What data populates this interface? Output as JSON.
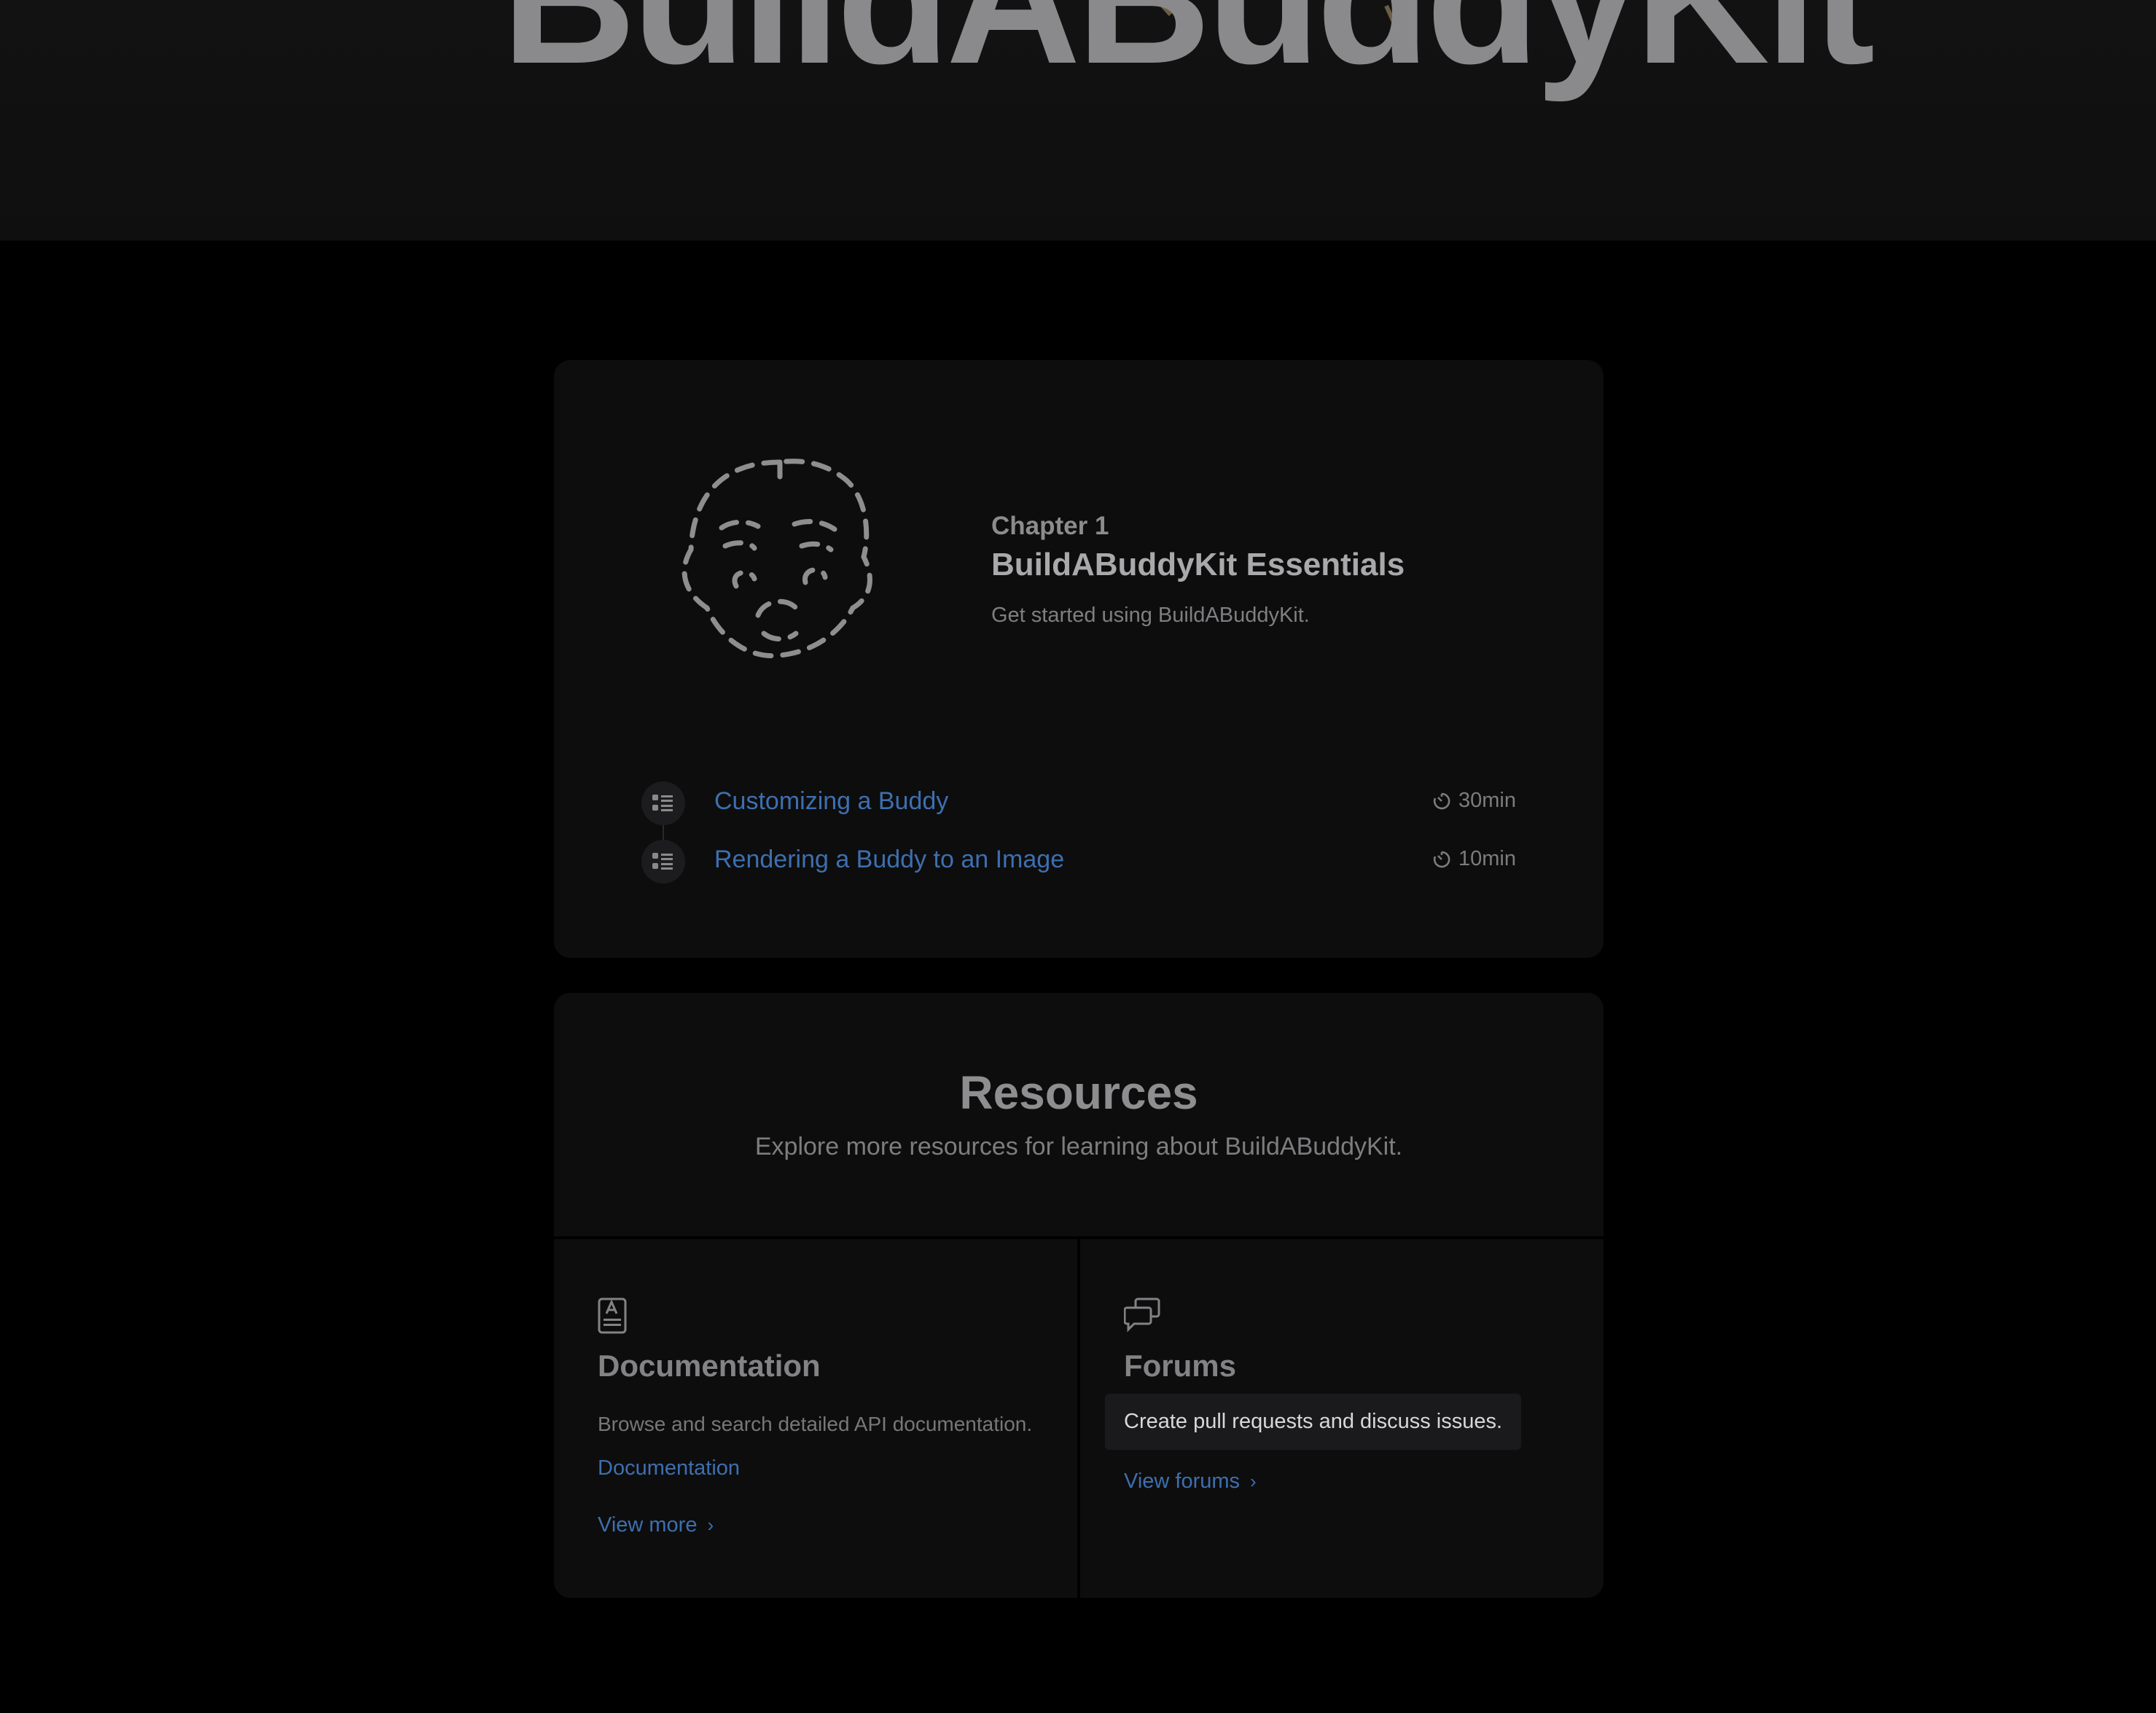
{
  "hero": {
    "title": "BuildABuddyKit"
  },
  "chapter": {
    "label": "Chapter 1",
    "title": "BuildABuddyKit Essentials",
    "description": "Get started using BuildABuddyKit.",
    "tutorials": [
      {
        "title": "Customizing a Buddy",
        "duration": "30min"
      },
      {
        "title": "Rendering a Buddy to an Image",
        "duration": "10min"
      }
    ]
  },
  "resources": {
    "title": "Resources",
    "subtitle": "Explore more resources for learning about BuildABuddyKit.",
    "documentation": {
      "heading": "Documentation",
      "text": "Browse and search detailed API documentation.",
      "link": "Documentation",
      "view_more": "View more"
    },
    "forums": {
      "heading": "Forums",
      "text": "Create pull requests and discuss issues.",
      "view_forums": "View forums"
    }
  },
  "colors": {
    "link": "#3d6fb0",
    "background": "#000000",
    "card": "#0d0d0d"
  },
  "icons": {
    "tutorial": "list-icon",
    "duration": "timer-icon",
    "documentation": "document-icon",
    "forums": "chat-bubbles-icon",
    "chevron": "chevron-right-icon"
  }
}
